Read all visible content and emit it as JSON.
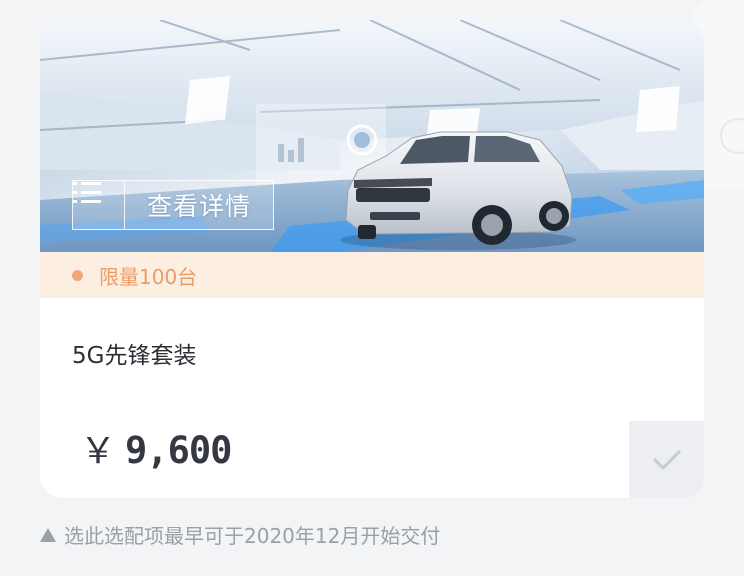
{
  "hero": {
    "details_label": "查看详情",
    "icons": {
      "details": "list-icon",
      "car": "car-image"
    }
  },
  "limit": {
    "text": "限量100台",
    "color": "#ec9c66"
  },
  "package": {
    "name": "5G先锋套装",
    "currency": "￥",
    "price": "9,600",
    "selected": false
  },
  "note": {
    "text": "选此选配项最早可于2020年12月开始交付",
    "icon": "triangle-up-icon"
  },
  "colors": {
    "limit_bg": "#fdeee2",
    "limit_dot": "#f2a779",
    "price_text": "#353842",
    "select_bg": "#eceef1"
  }
}
